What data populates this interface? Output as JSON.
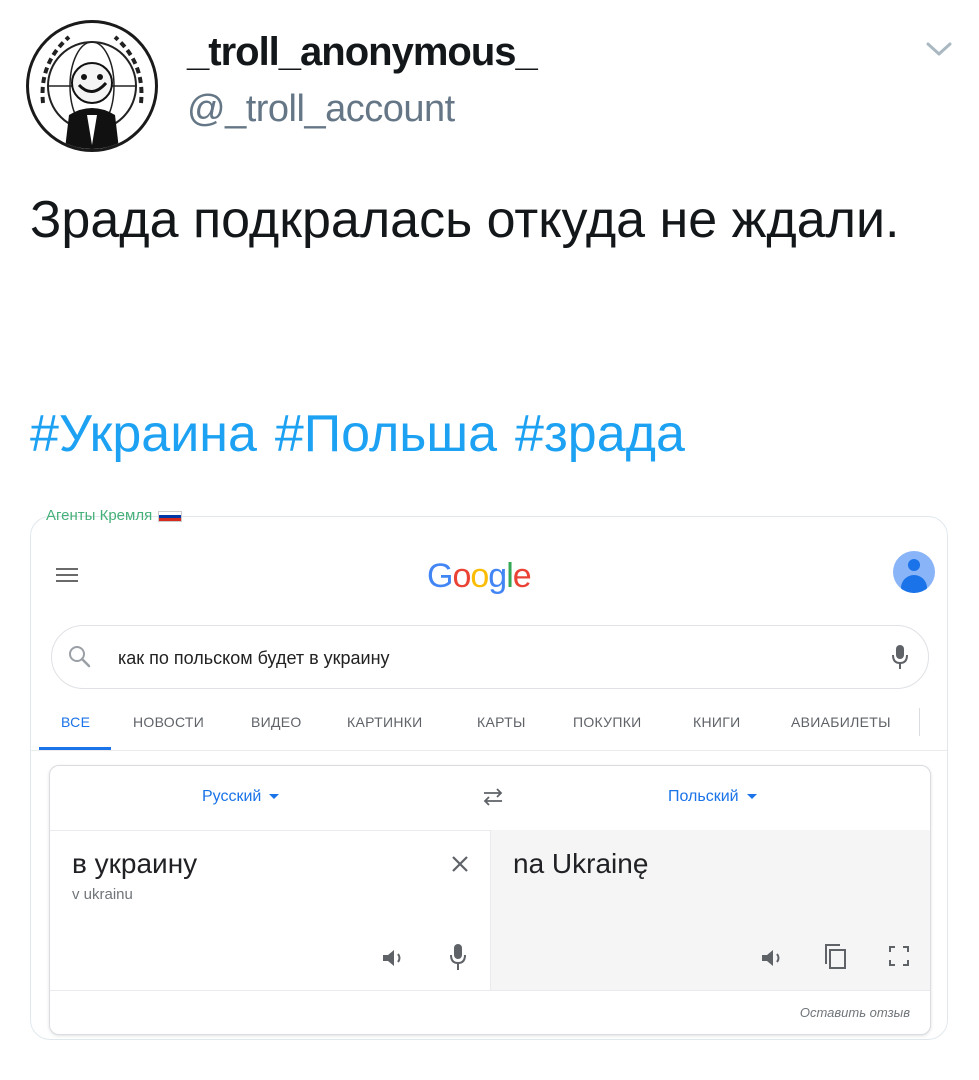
{
  "tweet": {
    "display_name": "_troll_anonymous_",
    "handle": "@_troll_account",
    "text": "Зрада подкралась откуда не ждали.",
    "hashtags": [
      "#Украина",
      "#Польша",
      "#зрада"
    ],
    "hashtag_color": "#1da1f2"
  },
  "embedded_image": {
    "watermark": "Агенты Кремля",
    "google": {
      "logo_letters": [
        "G",
        "o",
        "o",
        "g",
        "l",
        "e"
      ],
      "logo_colors": [
        "#4285f4",
        "#ea4335",
        "#fbbc05",
        "#4285f4",
        "#34a853",
        "#ea4335"
      ],
      "search_query": "как по польском будет в украину",
      "tabs": [
        {
          "label": "все",
          "active": true
        },
        {
          "label": "новости",
          "active": false
        },
        {
          "label": "видео",
          "active": false
        },
        {
          "label": "картинки",
          "active": false
        },
        {
          "label": "карты",
          "active": false
        },
        {
          "label": "покупки",
          "active": false
        },
        {
          "label": "книги",
          "active": false
        },
        {
          "label": "авиабилеты",
          "active": false
        }
      ],
      "accent_color": "#1a73e8"
    },
    "translate": {
      "source_lang": "Русский",
      "target_lang": "Польский",
      "source_text": "в украину",
      "source_transliteration": "v ukrainu",
      "target_text": "na Ukrainę",
      "feedback_label": "Оставить отзыв"
    }
  }
}
